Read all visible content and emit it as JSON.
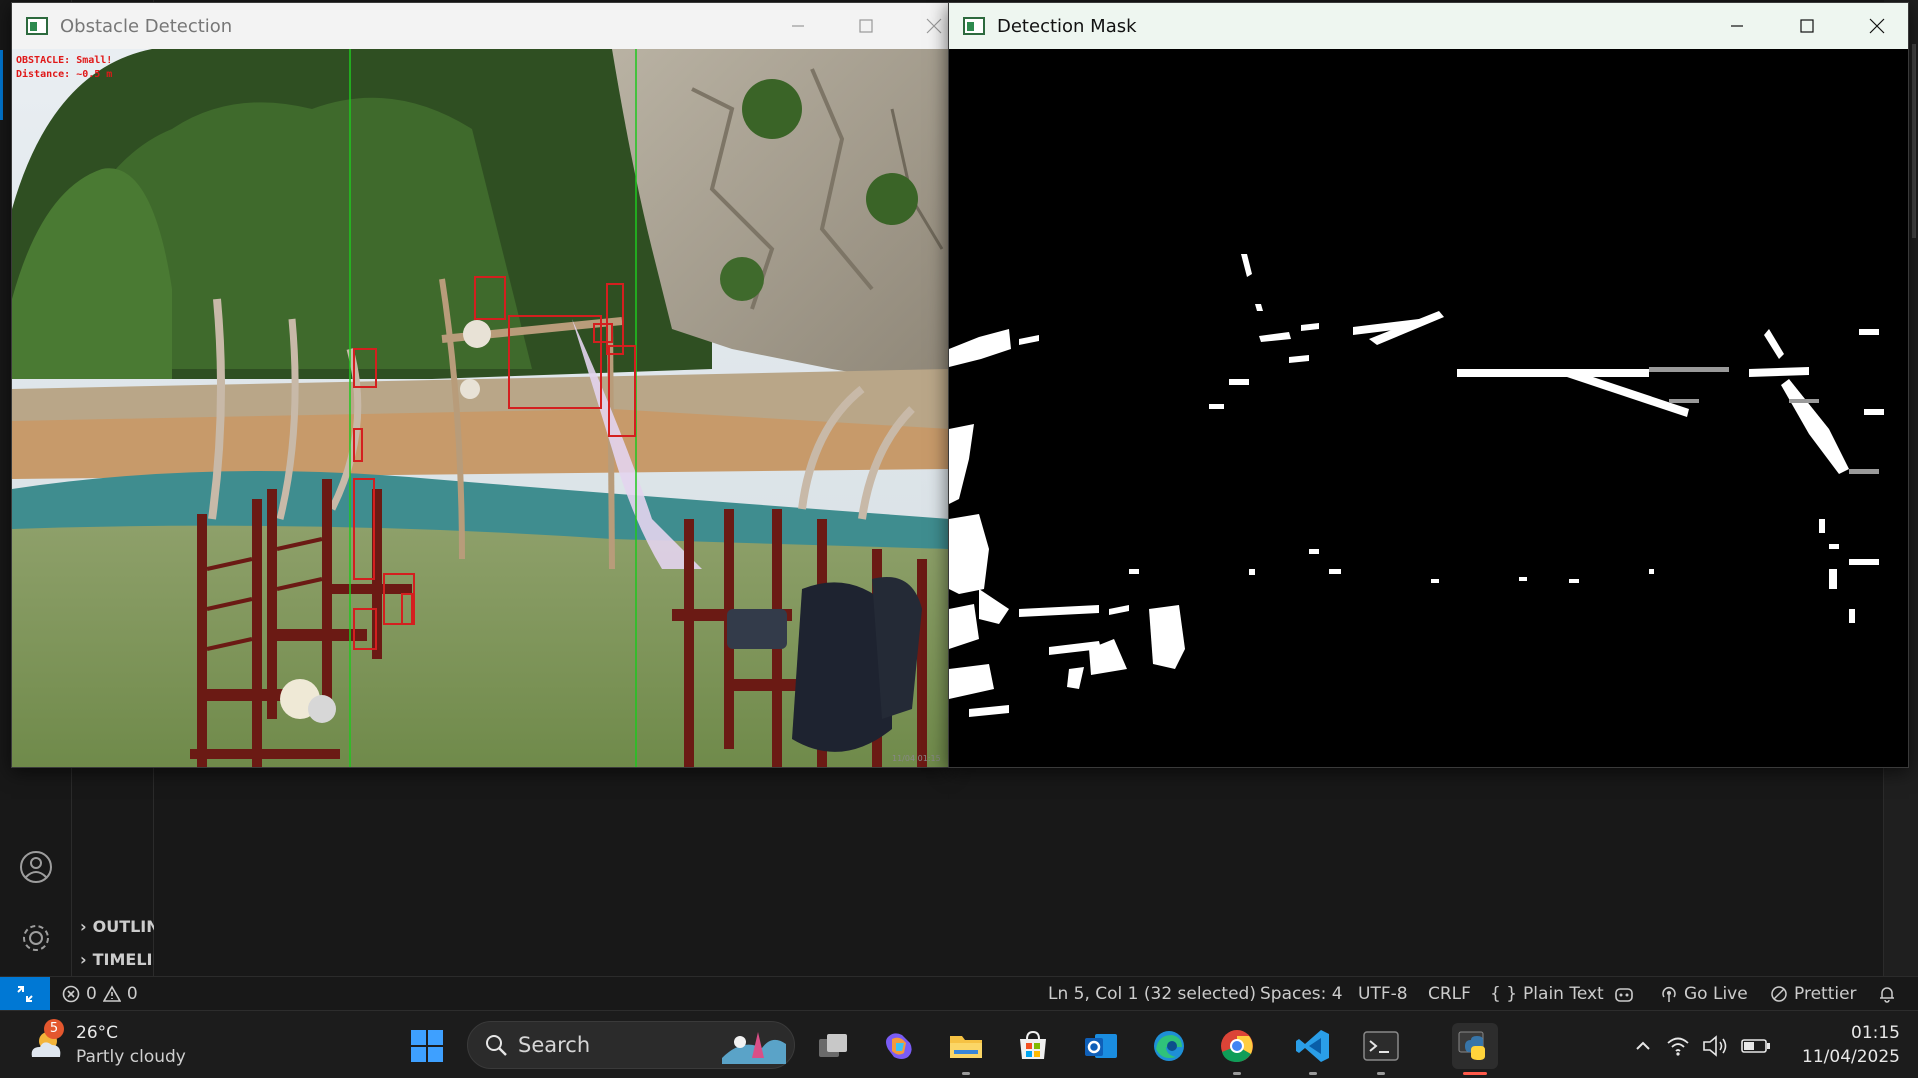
{
  "vscode": {
    "sidebar_sections": [
      "OUTLINE",
      "TIMELINE"
    ],
    "statusbar": {
      "errors": "0",
      "warnings": "0",
      "cursor": "Ln 5, Col 1 (32 selected)",
      "spaces": "Spaces: 4",
      "encoding": "UTF-8",
      "eol": "CRLF",
      "language": "Plain Text",
      "golive": "Go Live",
      "prettier": "Prettier"
    }
  },
  "windows": {
    "obstacle": {
      "title": "Obstacle Detection",
      "overlay_line1": "OBSTACLE: Small!",
      "overlay_line2": "Distance: ~0.5 m",
      "timestamp": "11/04 01:15"
    },
    "mask": {
      "title": "Detection Mask"
    }
  },
  "taskbar": {
    "weather_temp": "26°C",
    "weather_desc": "Partly cloudy",
    "weather_badge": "5",
    "search_label": "Search",
    "time": "01:15",
    "date": "11/04/2025",
    "apps": [
      "task-view",
      "copilot",
      "file-explorer",
      "microsoft-store",
      "outlook",
      "edge",
      "chrome",
      "vscode",
      "terminal",
      "python"
    ]
  },
  "colors": {
    "vscode_bg": "#181818",
    "accent": "#0078d4",
    "detection_box": "#d41f1f",
    "guide_line": "#1ec81e",
    "taskbar_bg": "#1c1c1c"
  }
}
